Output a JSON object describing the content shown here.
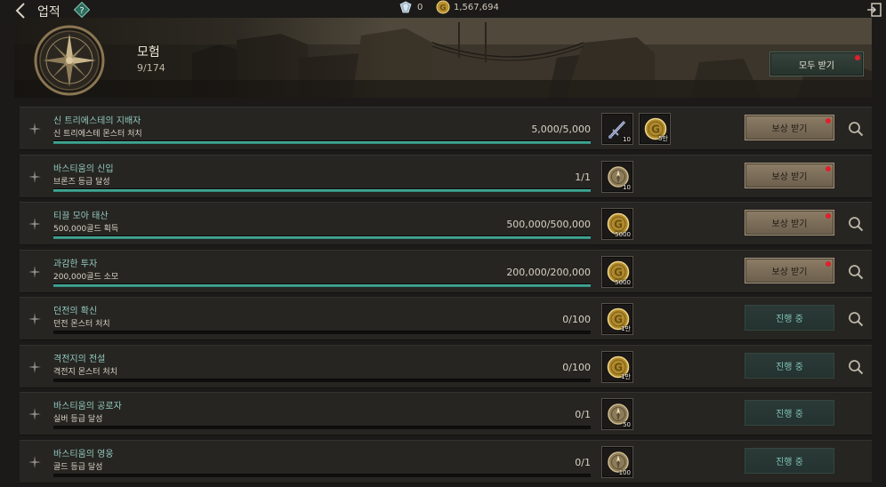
{
  "header": {
    "title": "업적",
    "crystal_amount": "0",
    "gold_amount": "1,567,694"
  },
  "banner": {
    "category": "모험",
    "progress": "9/174",
    "claim_all_label": "모두 받기"
  },
  "colors": {
    "progress_fill": "#3aa08c",
    "claim_button": "#7c6e5a",
    "status_button": "#283634",
    "notification_dot": "#e0202a"
  },
  "achievements": [
    {
      "title": "신 트리에스테의 지배자",
      "description": "신 트리에스테 몬스터 처치",
      "count": "5,000/5,000",
      "progress": 1.0,
      "rewards": [
        {
          "icon": "dagger-icon",
          "qty": "10"
        },
        {
          "icon": "gold-coin-icon",
          "qty": "5만"
        }
      ],
      "action": "보상 받기",
      "claimable": true,
      "magnifier": true
    },
    {
      "title": "바스티움의 신입",
      "description": "브론즈 등급 달성",
      "count": "1/1",
      "progress": 1.0,
      "rewards": [
        {
          "icon": "compass-token-icon",
          "qty": "10"
        }
      ],
      "action": "보상 받기",
      "claimable": true,
      "magnifier": false
    },
    {
      "title": "티끌 모아 태산",
      "description": "500,000골드 획득",
      "count": "500,000/500,000",
      "progress": 1.0,
      "rewards": [
        {
          "icon": "gold-coin-icon",
          "qty": "5000"
        }
      ],
      "action": "보상 받기",
      "claimable": true,
      "magnifier": true
    },
    {
      "title": "과감한 투자",
      "description": "200,000골드 소모",
      "count": "200,000/200,000",
      "progress": 1.0,
      "rewards": [
        {
          "icon": "gold-coin-icon",
          "qty": "5000"
        }
      ],
      "action": "보상 받기",
      "claimable": true,
      "magnifier": true
    },
    {
      "title": "던전의 확신",
      "description": "던전 몬스터 처치",
      "count": "0/100",
      "progress": 0,
      "rewards": [
        {
          "icon": "gold-coin-icon",
          "qty": "1만"
        }
      ],
      "action": "진행 중",
      "claimable": false,
      "magnifier": true
    },
    {
      "title": "격전지의 전설",
      "description": "격전지 몬스터 처치",
      "count": "0/100",
      "progress": 0,
      "rewards": [
        {
          "icon": "gold-coin-icon",
          "qty": "1만"
        }
      ],
      "action": "진행 중",
      "claimable": false,
      "magnifier": true
    },
    {
      "title": "바스티움의 공로자",
      "description": "실버 등급 달성",
      "count": "0/1",
      "progress": 0,
      "rewards": [
        {
          "icon": "compass-token-icon",
          "qty": "50"
        }
      ],
      "action": "진행 중",
      "claimable": false,
      "magnifier": false
    },
    {
      "title": "바스티움의 영웅",
      "description": "골드 등급 달성",
      "count": "0/1",
      "progress": 0,
      "rewards": [
        {
          "icon": "compass-token-icon",
          "qty": "100"
        }
      ],
      "action": "진행 중",
      "claimable": false,
      "magnifier": false
    }
  ]
}
